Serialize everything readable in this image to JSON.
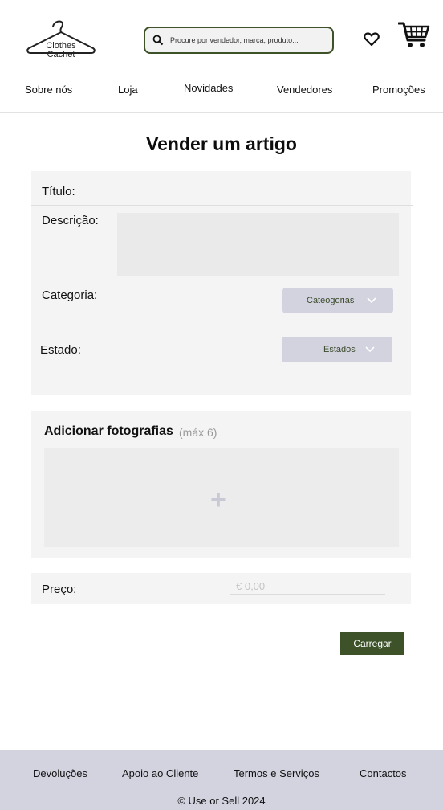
{
  "brand": {
    "name_line1": "Clothes",
    "name_line2": "Cachet"
  },
  "search": {
    "placeholder": "Procure por vendedor, marca, produto..."
  },
  "nav": {
    "items": [
      "Sobre nós",
      "Loja",
      "Novidades",
      "Vendedores",
      "Promoções"
    ]
  },
  "page": {
    "title": "Vender um artigo"
  },
  "form": {
    "title_label": "Título:",
    "description_label": "Descrição:",
    "category_label": "Categoria:",
    "category_dropdown": "Cateogorias",
    "state_label": "Estado:",
    "state_dropdown": "Estados",
    "photos_title": "Adicionar fotografias",
    "photos_max": "(máx 6)",
    "photos_plus": "+",
    "price_label": "Preço:",
    "price_placeholder": "€ 0,00",
    "upload_label": "Carregar"
  },
  "footer": {
    "links": [
      "Devoluções",
      "Apoio ao Cliente",
      "Termos e Serviços",
      "Contactos"
    ],
    "copyright": "© Use or Sell 2024"
  },
  "colors": {
    "accent_green": "#3d5229",
    "footer_bg": "#d3d3e0",
    "card_bg": "#f4f4f4"
  }
}
